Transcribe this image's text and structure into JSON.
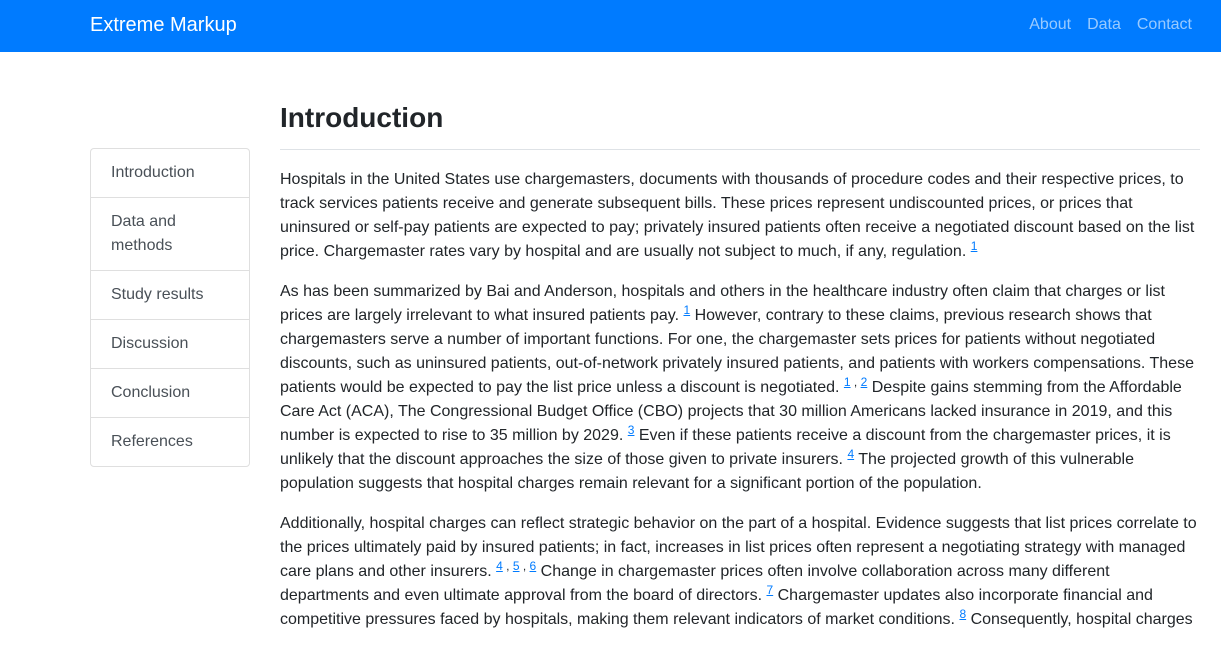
{
  "navbar": {
    "brand": "Extreme Markup",
    "links": [
      {
        "label": "About"
      },
      {
        "label": "Data"
      },
      {
        "label": "Contact"
      }
    ]
  },
  "sidebar": {
    "items": [
      {
        "label": "Introduction"
      },
      {
        "label": "Data and methods"
      },
      {
        "label": "Study results"
      },
      {
        "label": "Discussion"
      },
      {
        "label": "Conclusion"
      },
      {
        "label": "References"
      }
    ]
  },
  "main": {
    "title": "Introduction",
    "paragraphs": [
      [
        {
          "text": "Hospitals in the United States use chargemasters, documents with thousands of procedure codes and their respective prices, to track services patients receive and generate subsequent bills. These prices represent undiscounted prices, or prices that uninsured or self-pay patients are expected to pay; privately insured patients often receive a negotiated discount based on the list price. Chargemaster rates vary by hospital and are usually not subject to much, if any, regulation. "
        },
        {
          "ref": "1"
        }
      ],
      [
        {
          "text": "As has been summarized by Bai and Anderson, hospitals and others in the healthcare industry often claim that charges or list prices are largely irrelevant to what insured patients pay. "
        },
        {
          "ref": "1"
        },
        {
          "text": " However, contrary to these claims, previous research shows that chargemasters serve a number of important functions. For one, the chargemaster sets prices for patients without negotiated discounts, such as uninsured patients, out-of-network privately insured patients, and patients with workers compensations. These patients would be expected to pay the list price unless a discount is negotiated. "
        },
        {
          "ref": "1"
        },
        {
          "sep": " , "
        },
        {
          "ref": "2"
        },
        {
          "text": " Despite gains stemming from the Affordable Care Act (ACA), The Congressional Budget Office (CBO) projects that 30 million Americans lacked insurance in 2019, and this number is expected to rise to 35 million by 2029. "
        },
        {
          "ref": "3"
        },
        {
          "text": " Even if these patients receive a discount from the chargemaster prices, it is unlikely that the discount approaches the size of those given to private insurers. "
        },
        {
          "ref": "4"
        },
        {
          "text": " The projected growth of this vulnerable population suggests that hospital charges remain relevant for a significant portion of the population."
        }
      ],
      [
        {
          "text": "Additionally, hospital charges can reflect strategic behavior on the part of a hospital. Evidence suggests that list prices correlate to the prices ultimately paid by insured patients; in fact, increases in list prices often represent a negotiating strategy with managed care plans and other insurers. "
        },
        {
          "ref": "4"
        },
        {
          "sep": " , "
        },
        {
          "ref": "5"
        },
        {
          "sep": " , "
        },
        {
          "ref": "6"
        },
        {
          "text": " Change in chargemaster prices often involve collaboration across many different departments and even ultimate approval from the board of directors. "
        },
        {
          "ref": "7"
        },
        {
          "text": " Chargemaster updates also incorporate financial and competitive pressures faced by hospitals, making them relevant indicators of market conditions. "
        },
        {
          "ref": "8"
        },
        {
          "text": " Consequently, hospital charges"
        }
      ]
    ]
  }
}
